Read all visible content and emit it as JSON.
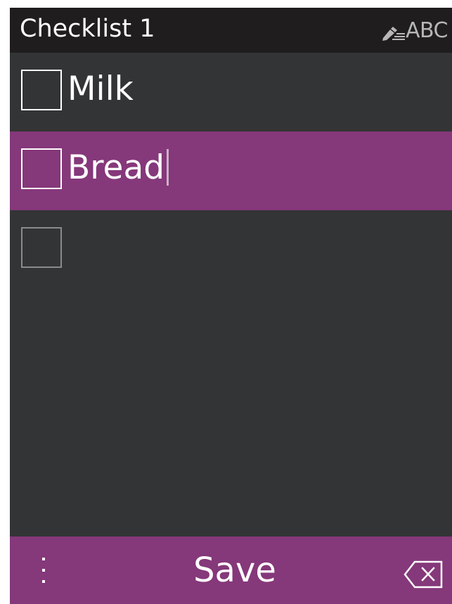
{
  "header": {
    "title": "Checklist 1",
    "input_mode": "ABC",
    "input_mode_icon": "pen-lines-icon"
  },
  "checklist": {
    "items": [
      {
        "label": "Milk",
        "checked": false,
        "selected": false
      },
      {
        "label": "Bread",
        "checked": false,
        "selected": true
      },
      {
        "label": "",
        "checked": false,
        "selected": false
      }
    ]
  },
  "softkeys": {
    "left_icon": "vertical-ellipsis-icon",
    "center_label": "Save",
    "right_icon": "backspace-icon"
  },
  "colors": {
    "background": "#333435",
    "header": "#1f1d1d",
    "accent": "#85387a"
  }
}
